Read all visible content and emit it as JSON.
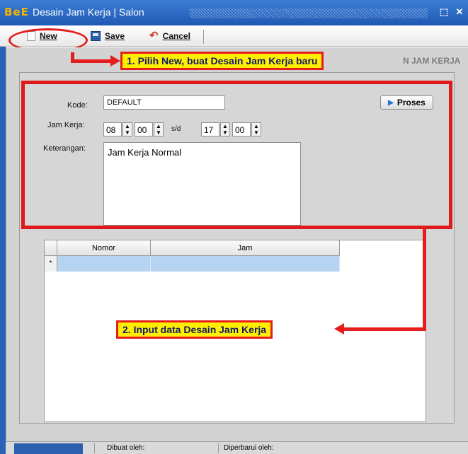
{
  "window": {
    "logo": "BeE",
    "title": "Desain Jam Kerja | Salon"
  },
  "toolbar": {
    "new_label": "New",
    "save_label": "Save",
    "cancel_label": "Cancel"
  },
  "header": {
    "section_title_partial": "N JAM KERJA"
  },
  "form": {
    "kode_label": "Kode:",
    "kode_value": "DEFAULT",
    "jam_label": "Jam Kerja:",
    "jam_start_hour": "08",
    "jam_start_minute": "00",
    "range_separator": "s/d",
    "jam_end_hour": "17",
    "jam_end_minute": "00",
    "keterangan_label": "Keterangan:",
    "keterangan_value": "Jam Kerja Normal",
    "proses_label": "Proses"
  },
  "grid": {
    "columns": [
      "Nomor",
      "Jam"
    ],
    "new_row_marker": "*"
  },
  "statusbar": {
    "dibuat_label": "Dibuat oleh:",
    "diperbarui_label": "Diperbarui oleh:"
  },
  "annotations": {
    "callout1": "1. Pilih New, buat Desain Jam Kerja baru",
    "callout2": "2. Input data Desain Jam Kerja"
  },
  "colors": {
    "accent_red": "#e41d1d",
    "callout_yellow": "#ffee00",
    "title_blue": "#2b62b7",
    "grid_selection": "#b7d3f2"
  }
}
